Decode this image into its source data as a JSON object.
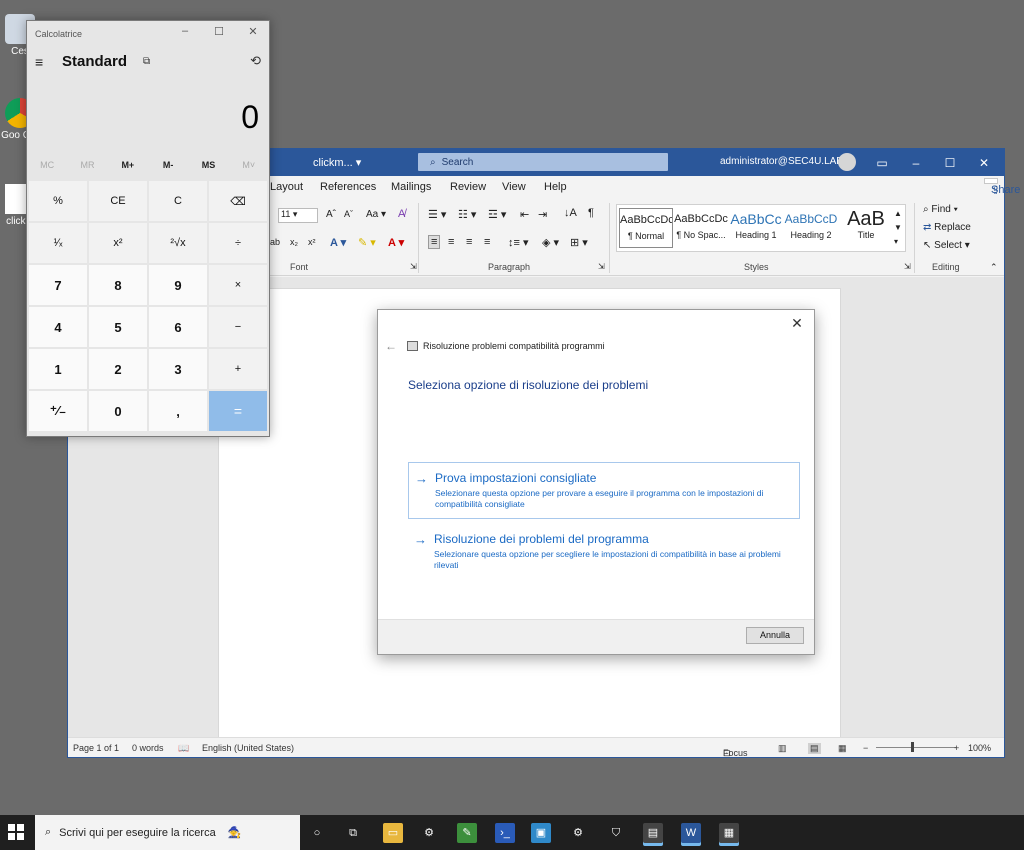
{
  "desktop": {
    "icons": [
      {
        "label": "Ces",
        "icon": "recycle-bin-icon"
      },
      {
        "label": "Goo Chr",
        "icon": "chrome-icon"
      },
      {
        "label": "clickm",
        "icon": "document-icon"
      }
    ]
  },
  "word": {
    "doc_name": "clickm... ▾",
    "search_placeholder": "Search",
    "user": "administrator@SEC4U.LAB",
    "tabs": [
      "Layout",
      "References",
      "Mailings",
      "Review",
      "View",
      "Help"
    ],
    "share_label": "Share",
    "font_size": "11",
    "groups": {
      "font": "Font",
      "paragraph": "Paragraph",
      "styles": "Styles",
      "editing": "Editing"
    },
    "styles": [
      {
        "sample": "AaBbCcDc",
        "name": "¶ Normal"
      },
      {
        "sample": "AaBbCcDc",
        "name": "¶ No Spac..."
      },
      {
        "sample": "AaBbCc",
        "name": "Heading 1"
      },
      {
        "sample": "AaBbCcD",
        "name": "Heading 2"
      },
      {
        "sample": "AaB",
        "name": "Title"
      }
    ],
    "editing": {
      "find": "Find",
      "replace": "Replace",
      "select": "Select"
    },
    "status": {
      "page": "Page 1 of 1",
      "words": "0 words",
      "language": "English (United States)",
      "focus": "Focus",
      "zoom": "100%"
    }
  },
  "dialog": {
    "title": "Risoluzione problemi compatibilità programmi",
    "heading": "Seleziona opzione di risoluzione dei problemi",
    "options": [
      {
        "title": "Prova impostazioni consigliate",
        "desc": "Selezionare questa opzione per provare a eseguire il programma con le impostazioni di compatibilità consigliate"
      },
      {
        "title": "Risoluzione dei problemi del programma",
        "desc": "Selezionare questa opzione per scegliere le impostazioni di compatibilità in base ai problemi rilevati"
      }
    ],
    "cancel": "Annulla"
  },
  "calculator": {
    "title": "Calcolatrice",
    "mode": "Standard",
    "display": "0",
    "memory": [
      "MC",
      "MR",
      "M+",
      "M-",
      "MS",
      "M˅"
    ],
    "keys": [
      "%",
      "CE",
      "C",
      "⌫",
      "¹⁄ₓ",
      "x²",
      "²√x",
      "÷",
      "7",
      "8",
      "9",
      "×",
      "4",
      "5",
      "6",
      "−",
      "1",
      "2",
      "3",
      "+",
      "⁺⁄₋",
      "0",
      ",",
      "="
    ]
  },
  "taskbar": {
    "search_placeholder": "Scrivi qui per eseguire la ricerca"
  },
  "colors": {
    "word_blue": "#2b579a",
    "link_blue": "#1b6ac4",
    "equals_blue": "#90bce9",
    "desktop": "#6b6b6b",
    "taskbar": "#1f1f1f"
  }
}
